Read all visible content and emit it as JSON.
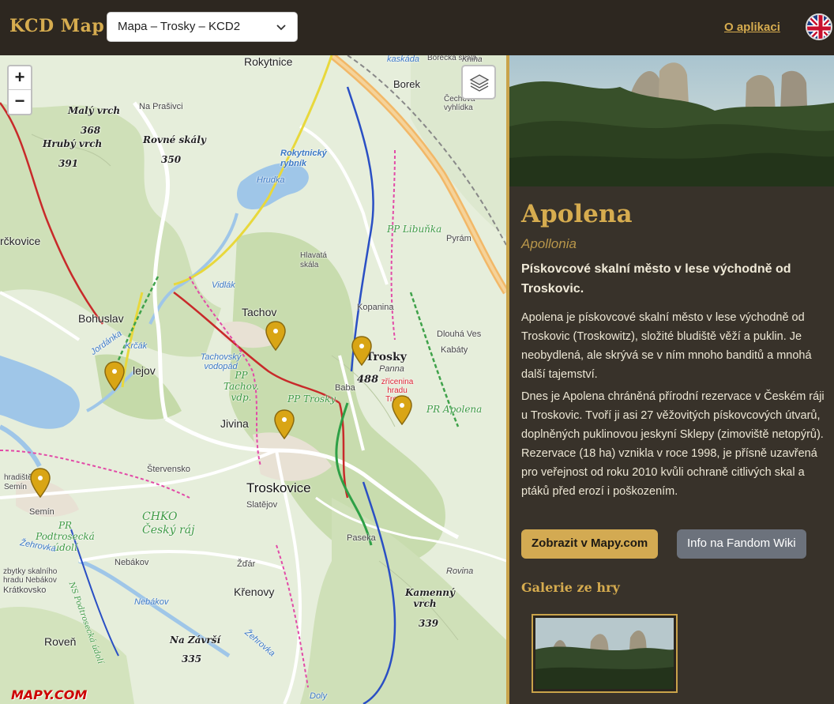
{
  "header": {
    "logo": "KCD Map",
    "select": {
      "value": "Mapa – Trosky – KCD2"
    },
    "about_link": "O aplikaci",
    "language_icon": "uk-flag-icon"
  },
  "map": {
    "zoom_in": "+",
    "zoom_out": "−",
    "layers_icon": "layers-icon",
    "attribution": "MAPY.COM",
    "labels": {
      "rokytnice": "Rokytnice",
      "borek": "Borek",
      "kaskada": "kaskáda",
      "borecka_skala": "Borecká skala",
      "kniha": "Kniha",
      "cechova_vyhlidka": "Čechova vyhlídka",
      "na_prasivci": "Na Prašivci",
      "maly_vrch": "Malý vrch",
      "maly_vrch_alt": "368",
      "hruby_vrch": "Hrubý vrch",
      "hruby_vrch_alt": "391",
      "rovne_skaly": "Rovné skály",
      "rovne_skaly_alt": "350",
      "rokytnicky_rybnik": "Rokytnický rybník",
      "hrudka": "Hrudka",
      "pp_libunka": "PP Libuňka",
      "pyram": "Pyrám",
      "rckovice": "rčkovice",
      "hlavata_skala": "Hlavatá skála",
      "vidlak": "Vidlák",
      "kopanina": "Kopanina",
      "tachov": "Tachov",
      "bohuslav": "Bohuslav",
      "krcak": "Krčák",
      "jordanka": "Jordánka",
      "dlouha_ves": "Dlouhá Ves",
      "kabaty": "Kabáty",
      "tachovsky_vodopad": "Tachovský vodopád",
      "pp_tachov": "PP Tachov. vdp.",
      "trosky": "Trosky",
      "panna": "Panna",
      "trosky_alt": "488",
      "zricenina": "zřícenina hradu Trosky",
      "baba": "Baba",
      "pp_trosky": "PP Trosky",
      "pr_apolena": "PR Apolena",
      "jivina": "Jivina",
      "sterversko": "Štervensko",
      "troskovice": "Troskovice",
      "slatejov": "Slatějov",
      "hradiste_semin": "hradiště Semín",
      "semin": "Semín",
      "chko": "CHKO Český ráj",
      "pr_podtrosecka": "PR Podtrosecká údolí",
      "zehrovka": "Žehrovka",
      "paseka": "Paseka",
      "nebakov": "Nebákov",
      "zbytky": "zbytky skalního hradu Nebákov",
      "kratkovsko": "Krátkovsko",
      "zdar": "Žďár",
      "rovina": "Rovina",
      "krenovy": "Křenovy",
      "ns_podtrosecka": "NS Podtrosecká údolí",
      "nebakov_blue": "Nebákov",
      "kamenny_vrch": "Kamenný vrch",
      "kamenny_vrch_alt": "339",
      "na_zavrsi": "Na Závrší",
      "na_zavrsi_alt": "335",
      "roven": "Roveň",
      "zehrovka2": "Žehrovka",
      "doly": "Doly",
      "rejov": "lejov"
    }
  },
  "detail": {
    "title": "Apolena",
    "subtitle": "Apollonia",
    "lead": "Pískovcové skalní město v lese východně od Troskovic.",
    "paragraph1": "Apolena je pískovcové skalní město v lese východně od Troskovic (Troskowitz), složité bludiště věží a puklin. Je neobydlená, ale skrývá se v ním mnoho banditů a mnohá další tajemství.",
    "paragraph2": "Dnes je Apolena chráněná přírodní rezervace v Českém ráji u Troskovic. Tvoří ji asi 27 věžovitých pískovcových útvarů, doplněných puklinovou jeskyní Sklepy (zimoviště netopýrů). Rezervace (18 ha) vznikla v roce 1998, je přísně uzavřená pro veřejnost od roku 2010 kvůli ochraně citlivých skal a ptáků před erozí i poškozením.",
    "btn_mapy": "Zobrazit v Mapy.com",
    "btn_wiki": "Info na Fandom Wiki",
    "gallery_title": "Galerie ze hry"
  },
  "colors": {
    "accent_gold": "#d6ac4f",
    "header_bg": "#2d2720",
    "sidebar_bg": "#38322a",
    "marker": "#d9a515"
  }
}
